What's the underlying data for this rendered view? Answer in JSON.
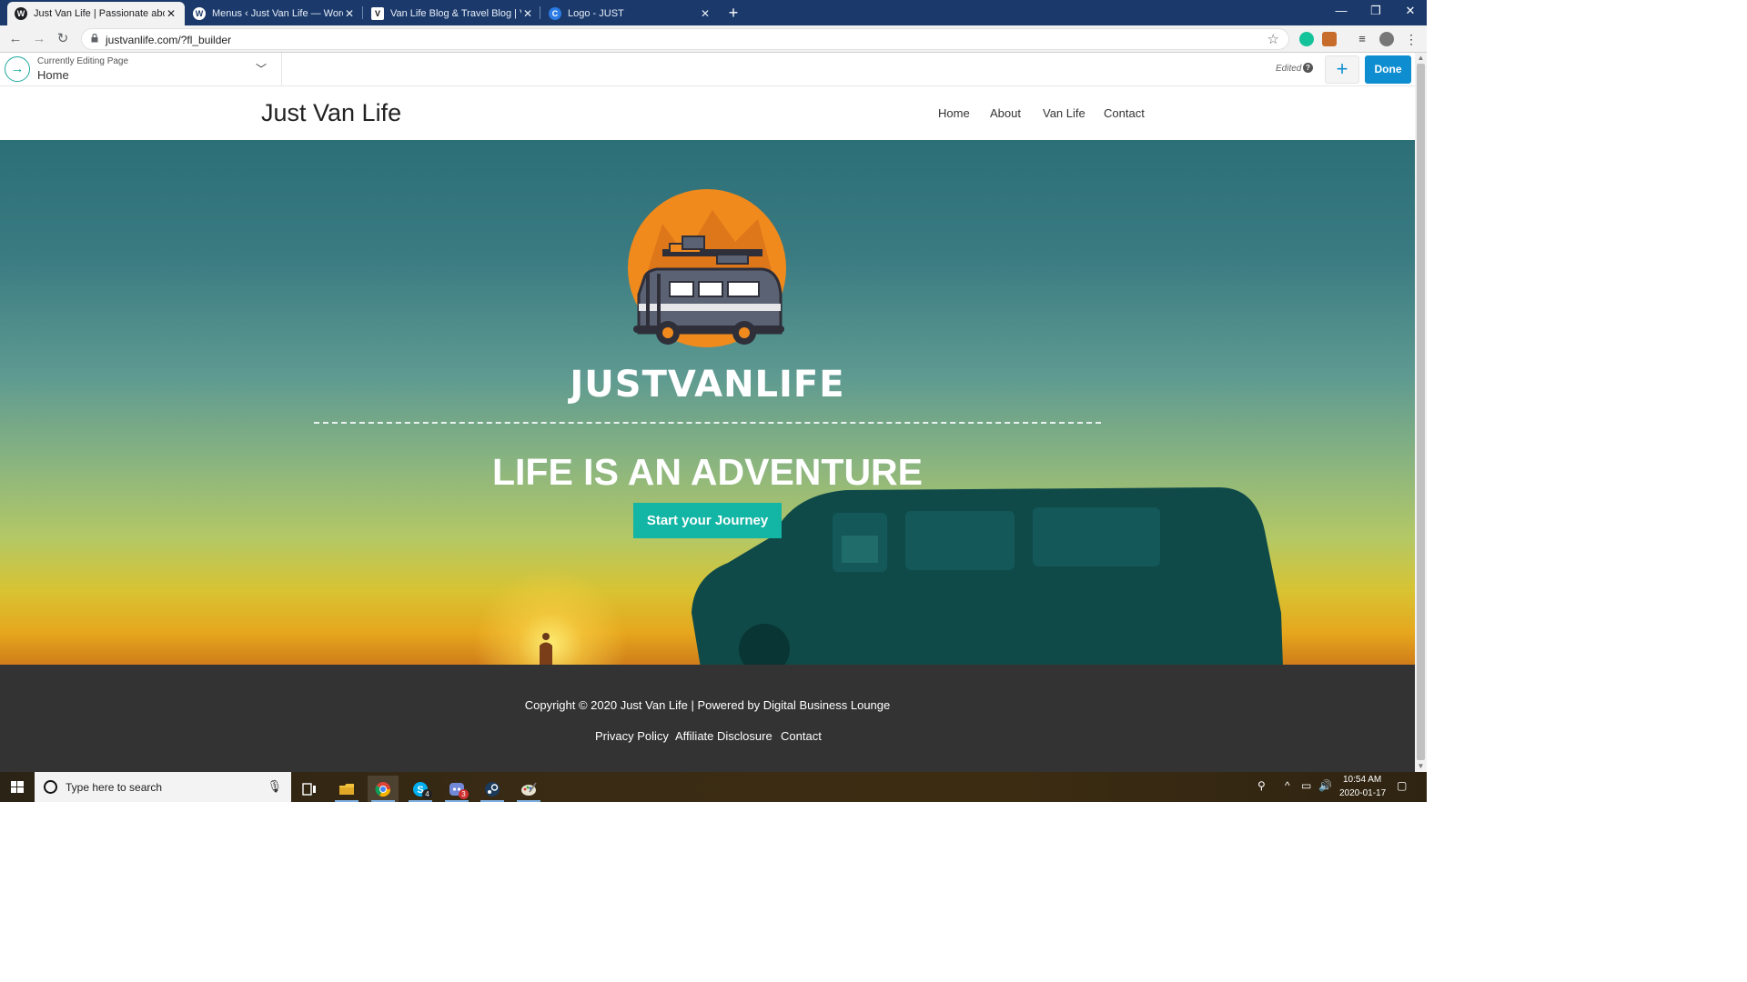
{
  "browser": {
    "tabs": [
      {
        "title": "Just Van Life | Passionate about a",
        "active": true,
        "favicon": "wordpress-icon"
      },
      {
        "title": "Menus ‹ Just Van Life — WordPress",
        "active": false,
        "favicon": "wordpress-icon"
      },
      {
        "title": "Van Life Blog & Travel Blog | Van",
        "active": false,
        "favicon": "v-icon"
      },
      {
        "title": "Logo - JUST",
        "active": false,
        "favicon": "canva-icon"
      }
    ],
    "url": "justvanlife.com/?fl_builder"
  },
  "builder": {
    "editing_label": "Currently Editing Page",
    "page_name": "Home",
    "status": "Edited",
    "help": "?",
    "done_label": "Done"
  },
  "site": {
    "title": "Just Van Life",
    "menu": [
      "Home",
      "About",
      "Van Life",
      "Contact"
    ]
  },
  "hero": {
    "brand": "JUSTVANLIFE",
    "headline": "LIFE IS AN ADVENTURE",
    "cta": "Start your Journey"
  },
  "footer": {
    "copyright": "Copyright © 2020 Just Van Life | Powered by Digital Business Lounge",
    "links": [
      "Privacy Policy",
      "Affiliate Disclosure",
      "Contact"
    ]
  },
  "taskbar": {
    "search_placeholder": "Type here to search",
    "apps": [
      {
        "name": "task-view-icon"
      },
      {
        "name": "file-explorer-icon"
      },
      {
        "name": "chrome-icon",
        "active": true
      },
      {
        "name": "skype-icon",
        "badge": "4"
      },
      {
        "name": "discord-icon",
        "badge": "3"
      },
      {
        "name": "steam-icon"
      },
      {
        "name": "paint-icon"
      }
    ],
    "time": "10:54 AM",
    "date": "2020-01-17"
  },
  "colors": {
    "builder_accent": "#0e8ed1",
    "cta_bg": "#13b5a4",
    "footer_bg": "#333333",
    "logo_orange": "#f08a1d"
  }
}
